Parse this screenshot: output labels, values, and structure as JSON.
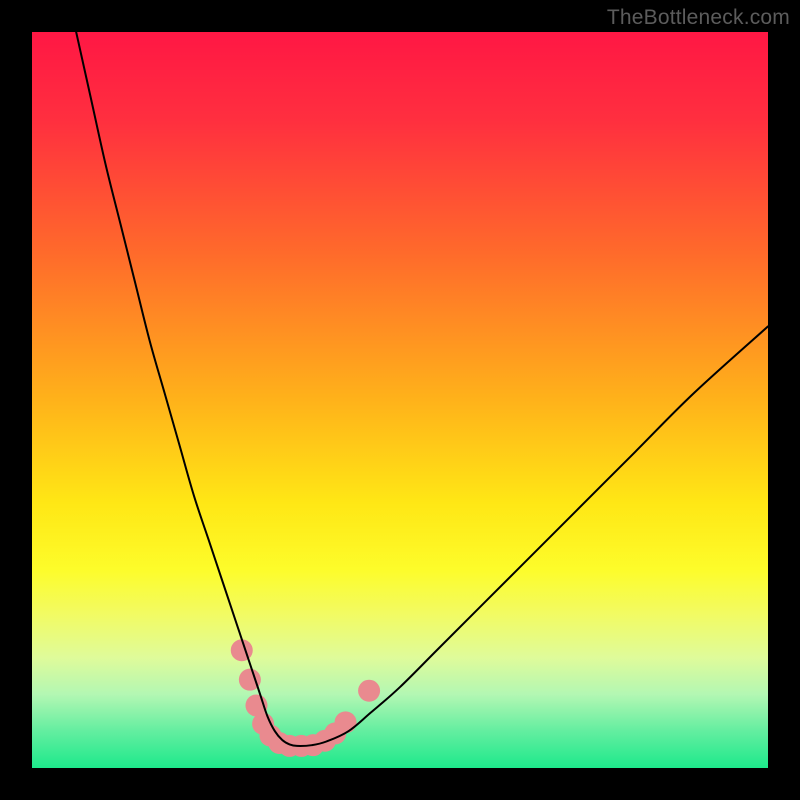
{
  "watermark": "TheBottleneck.com",
  "chart_data": {
    "type": "line",
    "title": "",
    "xlabel": "",
    "ylabel": "",
    "xlim": [
      0,
      100
    ],
    "ylim": [
      0,
      100
    ],
    "background_gradient_stops": [
      {
        "pct": 0,
        "color": "#ff1744"
      },
      {
        "pct": 12,
        "color": "#ff2f3f"
      },
      {
        "pct": 30,
        "color": "#ff6a2b"
      },
      {
        "pct": 50,
        "color": "#ffb21a"
      },
      {
        "pct": 64,
        "color": "#ffe715"
      },
      {
        "pct": 73,
        "color": "#fdfc2a"
      },
      {
        "pct": 79,
        "color": "#f2fb62"
      },
      {
        "pct": 85,
        "color": "#dffb9a"
      },
      {
        "pct": 90,
        "color": "#b3f7b3"
      },
      {
        "pct": 95,
        "color": "#63eea0"
      },
      {
        "pct": 100,
        "color": "#1de98b"
      }
    ],
    "series": [
      {
        "name": "bottleneck-curve",
        "stroke": "#000000",
        "stroke_width": 2,
        "x": [
          6,
          8,
          10,
          12,
          14,
          16,
          18,
          20,
          22,
          24,
          26,
          28,
          30,
          31,
          32,
          33,
          34,
          35,
          36,
          38,
          40,
          43,
          46,
          50,
          55,
          60,
          66,
          74,
          82,
          90,
          100
        ],
        "y": [
          100,
          91,
          82,
          74,
          66,
          58,
          51,
          44,
          37,
          31,
          25,
          19,
          13,
          10,
          7,
          5,
          3.8,
          3.2,
          3,
          3.1,
          3.6,
          5,
          7.5,
          11,
          16,
          21,
          27,
          35,
          43,
          51,
          60
        ]
      }
    ],
    "markers": {
      "name": "highlight-dots",
      "color": "#e98a8f",
      "radius": 11,
      "points": [
        {
          "x": 28.5,
          "y": 16
        },
        {
          "x": 29.6,
          "y": 12
        },
        {
          "x": 30.5,
          "y": 8.5
        },
        {
          "x": 31.4,
          "y": 6.0
        },
        {
          "x": 32.4,
          "y": 4.4
        },
        {
          "x": 33.6,
          "y": 3.4
        },
        {
          "x": 35.0,
          "y": 3.0
        },
        {
          "x": 36.6,
          "y": 3.0
        },
        {
          "x": 38.2,
          "y": 3.1
        },
        {
          "x": 39.8,
          "y": 3.7
        },
        {
          "x": 41.2,
          "y": 4.7
        },
        {
          "x": 42.6,
          "y": 6.2
        },
        {
          "x": 45.8,
          "y": 10.5
        }
      ]
    }
  }
}
